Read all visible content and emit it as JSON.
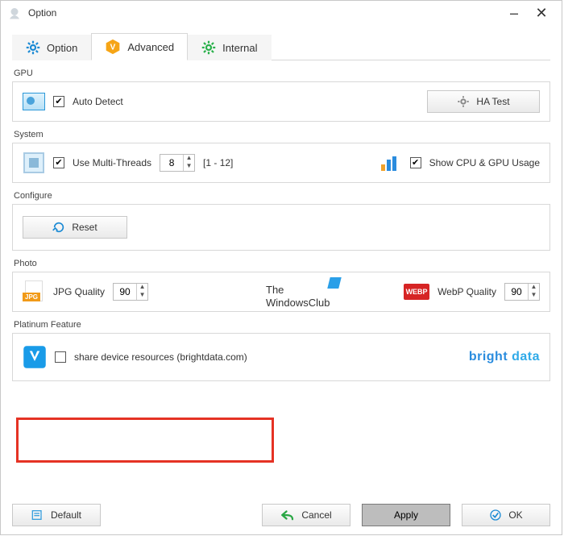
{
  "window": {
    "title": "Option"
  },
  "tabs": {
    "option": "Option",
    "advanced": "Advanced",
    "internal": "Internal"
  },
  "sections": {
    "gpu": {
      "label": "GPU",
      "auto_detect": "Auto Detect",
      "ha_test": "HA Test"
    },
    "system": {
      "label": "System",
      "use_multi_threads": "Use Multi-Threads",
      "threads_value": "8",
      "threads_range": "[1 - 12]",
      "show_cpu_gpu": "Show CPU & GPU Usage"
    },
    "configure": {
      "label": "Configure",
      "reset": "Reset",
      "watermark1": "The",
      "watermark2": "WindowsClub"
    },
    "photo": {
      "label": "Photo",
      "jpg_quality": "JPG Quality",
      "jpg_value": "90",
      "jpg_badge": "JPG",
      "webp_quality": "WebP Quality",
      "webp_value": "90",
      "webp_badge": "WEBP"
    },
    "platinum": {
      "label": "Platinum Feature",
      "share": "share device resources (brightdata.com)",
      "bright": "bright",
      "data": " data"
    }
  },
  "footer": {
    "default": "Default",
    "cancel": "Cancel",
    "apply": "Apply",
    "ok": "OK"
  }
}
